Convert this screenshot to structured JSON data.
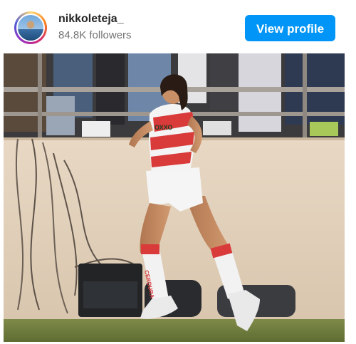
{
  "profile": {
    "username": "nikkoleteja_",
    "followers": "84.8K followers",
    "avatar_icon": "profile-photo-avatar"
  },
  "actions": {
    "view_profile_label": "View profile"
  },
  "post": {
    "image_alt": "soccer-player-photo",
    "sock_text": "CERDURA",
    "jersey_text": "ОХХО"
  },
  "colors": {
    "button": "#0095f6",
    "username": "#262626",
    "followers": "#737373",
    "kit_red": "#d93a3a"
  }
}
